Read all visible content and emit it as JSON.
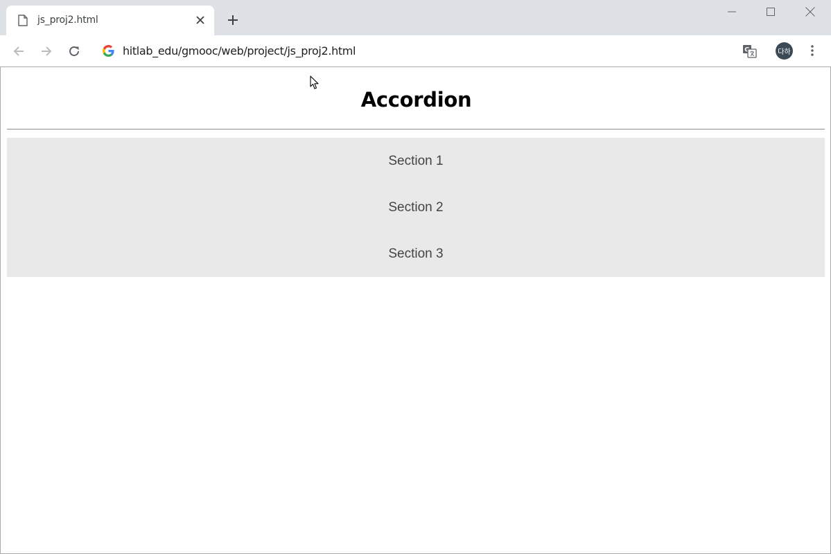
{
  "browser": {
    "tab_title": "js_proj2.html",
    "url": "hitlab_edu/gmooc/web/project/js_proj2.html",
    "profile_initials": "다하"
  },
  "page": {
    "title": "Accordion",
    "sections": [
      {
        "label": "Section 1"
      },
      {
        "label": "Section 2"
      },
      {
        "label": "Section 3"
      }
    ]
  },
  "colors": {
    "accordion_bg": "#e8e9e8",
    "titlebar_bg": "#dee1e6",
    "avatar_bg": "#3c4a55"
  },
  "icons": [
    "document-icon",
    "close-icon",
    "plus-icon",
    "minimize-icon",
    "maximize-icon",
    "window-close-icon",
    "back-arrow-icon",
    "forward-arrow-icon",
    "reload-icon",
    "google-icon",
    "translate-icon",
    "kebab-menu-icon",
    "mouse-cursor-icon"
  ]
}
